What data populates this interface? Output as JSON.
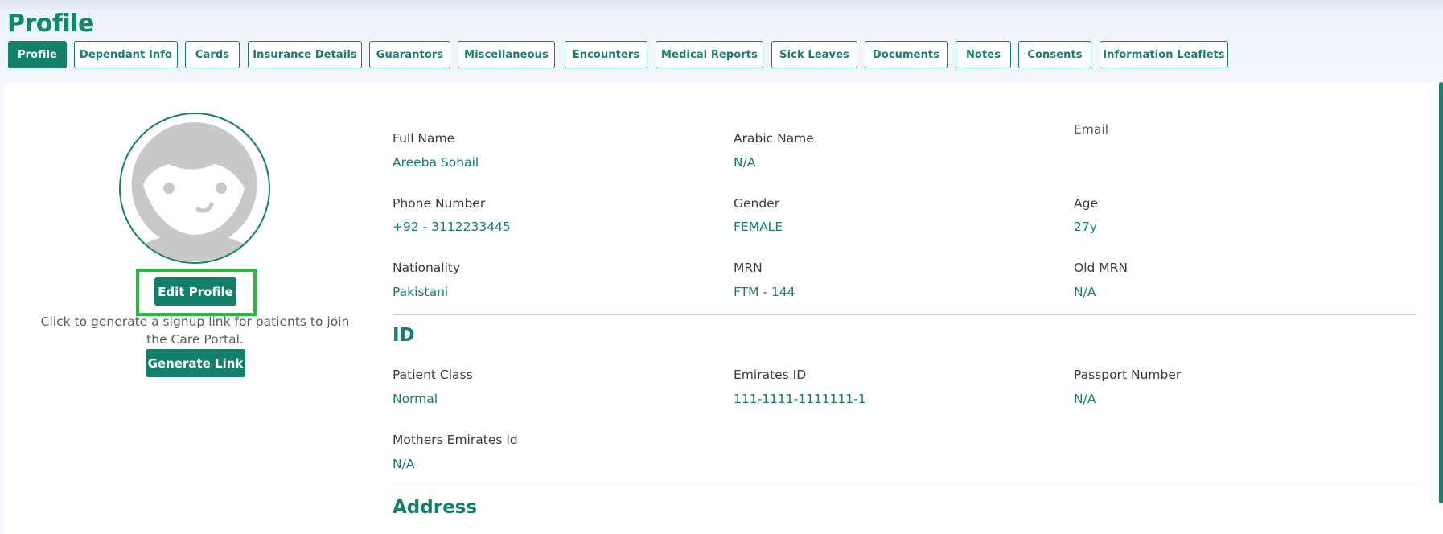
{
  "page_title": "Profile",
  "tabs": [
    {
      "label": "Profile",
      "active": true
    },
    {
      "label": "Dependant Info"
    },
    {
      "label": "Cards"
    },
    {
      "label": "Insurance Details"
    },
    {
      "label": "Guarantors"
    },
    {
      "label": "Miscellaneous"
    },
    {
      "label": "Encounters"
    },
    {
      "label": "Medical Reports"
    },
    {
      "label": "Sick Leaves"
    },
    {
      "label": "Documents"
    },
    {
      "label": "Notes"
    },
    {
      "label": "Consents"
    },
    {
      "label": "Information Leaflets"
    }
  ],
  "left_panel": {
    "avatar_icon": "user-avatar-placeholder-icon",
    "edit_profile_label": "Edit Profile",
    "signup_hint": "Click to generate a signup link for patients to join the Care Portal.",
    "generate_link_label": "Generate Link"
  },
  "fields": {
    "full_name": {
      "label": "Full Name",
      "value": "Areeba Sohail"
    },
    "arabic_name": {
      "label": "Arabic Name",
      "value": "N/A"
    },
    "email": {
      "label": "Email",
      "value": ""
    },
    "phone_number": {
      "label": "Phone Number",
      "value": "+92 - 3112233445"
    },
    "gender": {
      "label": "Gender",
      "value": "FEMALE"
    },
    "age": {
      "label": "Age",
      "value": "27y"
    },
    "nationality": {
      "label": "Nationality",
      "value": "Pakistani"
    },
    "mrn": {
      "label": "MRN",
      "value": "FTM - 144"
    },
    "old_mrn": {
      "label": "Old MRN",
      "value": "N/A"
    }
  },
  "id_section": {
    "title": "ID",
    "patient_class": {
      "label": "Patient Class",
      "value": "Normal"
    },
    "emirates_id": {
      "label": "Emirates ID",
      "value": "111-1111-1111111-1"
    },
    "passport_number": {
      "label": "Passport Number",
      "value": "N/A"
    },
    "mothers_emirates_id": {
      "label": "Mothers Emirates Id",
      "value": "N/A"
    }
  },
  "address_section": {
    "title": "Address"
  },
  "colors": {
    "accent": "#12806a",
    "highlight": "#28b93e"
  }
}
